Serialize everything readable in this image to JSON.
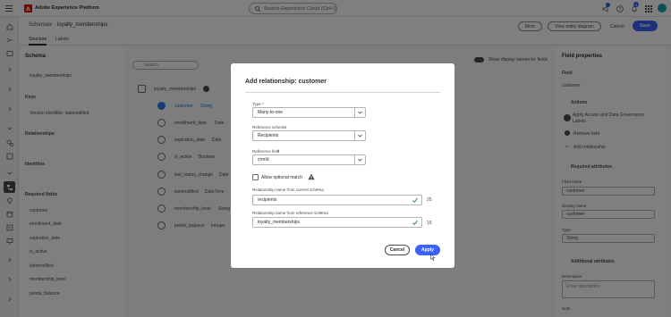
{
  "app": {
    "title": "Adobe Experience Platform",
    "search_placeholder": "Search Experience Cloud (Ctrl+/)",
    "notifications": "9",
    "brand_color": "#eb1000",
    "accent": "#3b63fb"
  },
  "breadcrumb": {
    "root": "Schemas",
    "current": "loyalty_memberships"
  },
  "tabs": [
    "Structure",
    "Labels"
  ],
  "header_buttons": {
    "more": "More",
    "entity": "View entity diagram",
    "cancel": "Cancel",
    "save": "Save"
  },
  "schema_panel": {
    "title": "Schema",
    "schema_name": "loyalty_memberships",
    "keys_label": "Keys",
    "version": "Version identifier: lastmodified",
    "relationships_label": "Relationships",
    "identities_label": "Identities",
    "required_label": "Required fields",
    "required_fields": [
      "customer",
      "enrollment_date",
      "expiration_date",
      "is_active",
      "lastmodified",
      "membership_level",
      "points_balance"
    ]
  },
  "canvas": {
    "search_placeholder": "Search",
    "toggle_label": "Show display names for fields",
    "root": "loyalty_memberships",
    "fields": [
      {
        "name": "customer",
        "type": "String"
      },
      {
        "name": "enrollment_date",
        "type": "Date"
      },
      {
        "name": "expiration_date",
        "type": "Date"
      },
      {
        "name": "is_active",
        "type": "Boolean"
      },
      {
        "name": "last_status_change",
        "type": "Date"
      },
      {
        "name": "lastmodified",
        "type": "DateTime"
      },
      {
        "name": "membership_level",
        "type": "String"
      },
      {
        "name": "points_balance",
        "type": "Integer"
      }
    ]
  },
  "properties": {
    "title": "Field properties",
    "field_label": "Field",
    "field_value": "customer",
    "actions_label": "Actions",
    "actions": [
      "Apply Access and Data Governance Labels",
      "Remove field",
      "Add relationship"
    ],
    "required_attrs": "Required attributes",
    "field_name_label": "Field name",
    "field_name": "customer",
    "display_name_label": "Display name",
    "display_name": "customer",
    "type_label": "Type",
    "type_value": "String",
    "additional": "Additional attributes",
    "description_label": "Description",
    "description_placeholder": "Enter description",
    "note_label": "Note"
  },
  "modal": {
    "title": "Add relationship: customer",
    "type_label": "Type",
    "type_value": "Many-to-one",
    "ref_schema_label": "Reference schema",
    "ref_schema_value": "Recipients",
    "ref_field_label": "Reference field",
    "ref_field_value": "crmId",
    "optional_label": "Allow optional match",
    "current_name_label": "Relationship name from current schema",
    "current_name_value": "recipients",
    "current_count": "25",
    "reference_name_label": "Relationship name from reference schema",
    "reference_name_value": "loyalty_memberships",
    "reference_count": "16",
    "cancel": "Cancel",
    "apply": "Apply"
  }
}
